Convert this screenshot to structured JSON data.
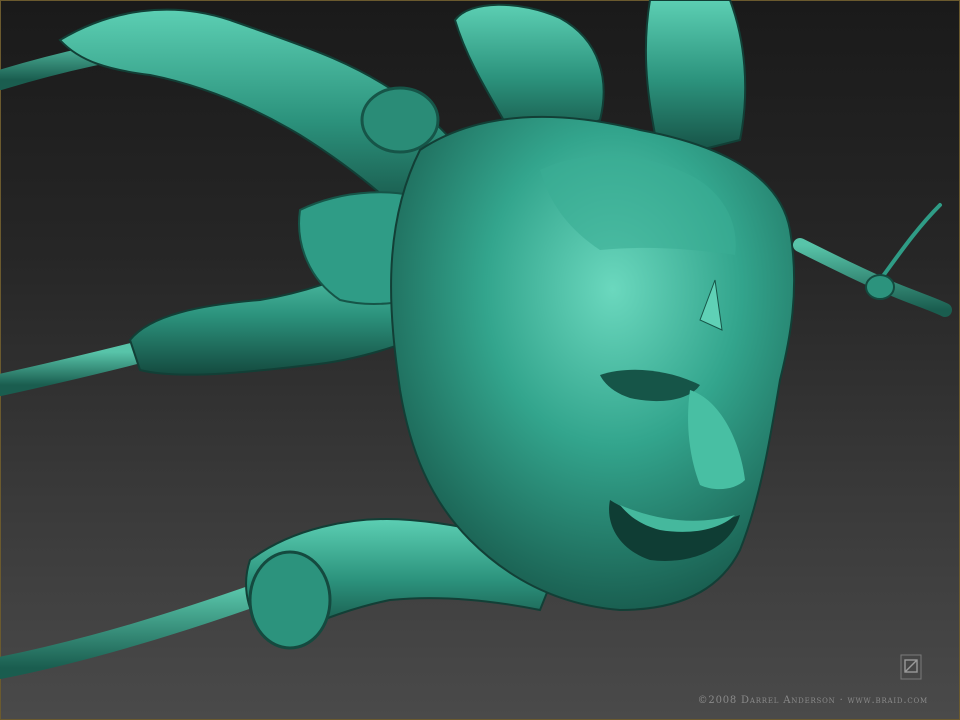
{
  "image": {
    "subject": "digital sculpt render",
    "colors": {
      "background_top": "#1a1a1a",
      "background_bottom": "#4a4a4a",
      "sculpt_base": "#2f9c86",
      "sculpt_highlight": "#5fd1b6",
      "sculpt_shadow": "#17594c",
      "frame_border": "#6b5a2e",
      "credit_text": "#8a8a8a"
    }
  },
  "credit": {
    "text": "©2008 Darrel Anderson · www.braid.com"
  },
  "logo": {
    "icon": "braid-logo-icon"
  }
}
